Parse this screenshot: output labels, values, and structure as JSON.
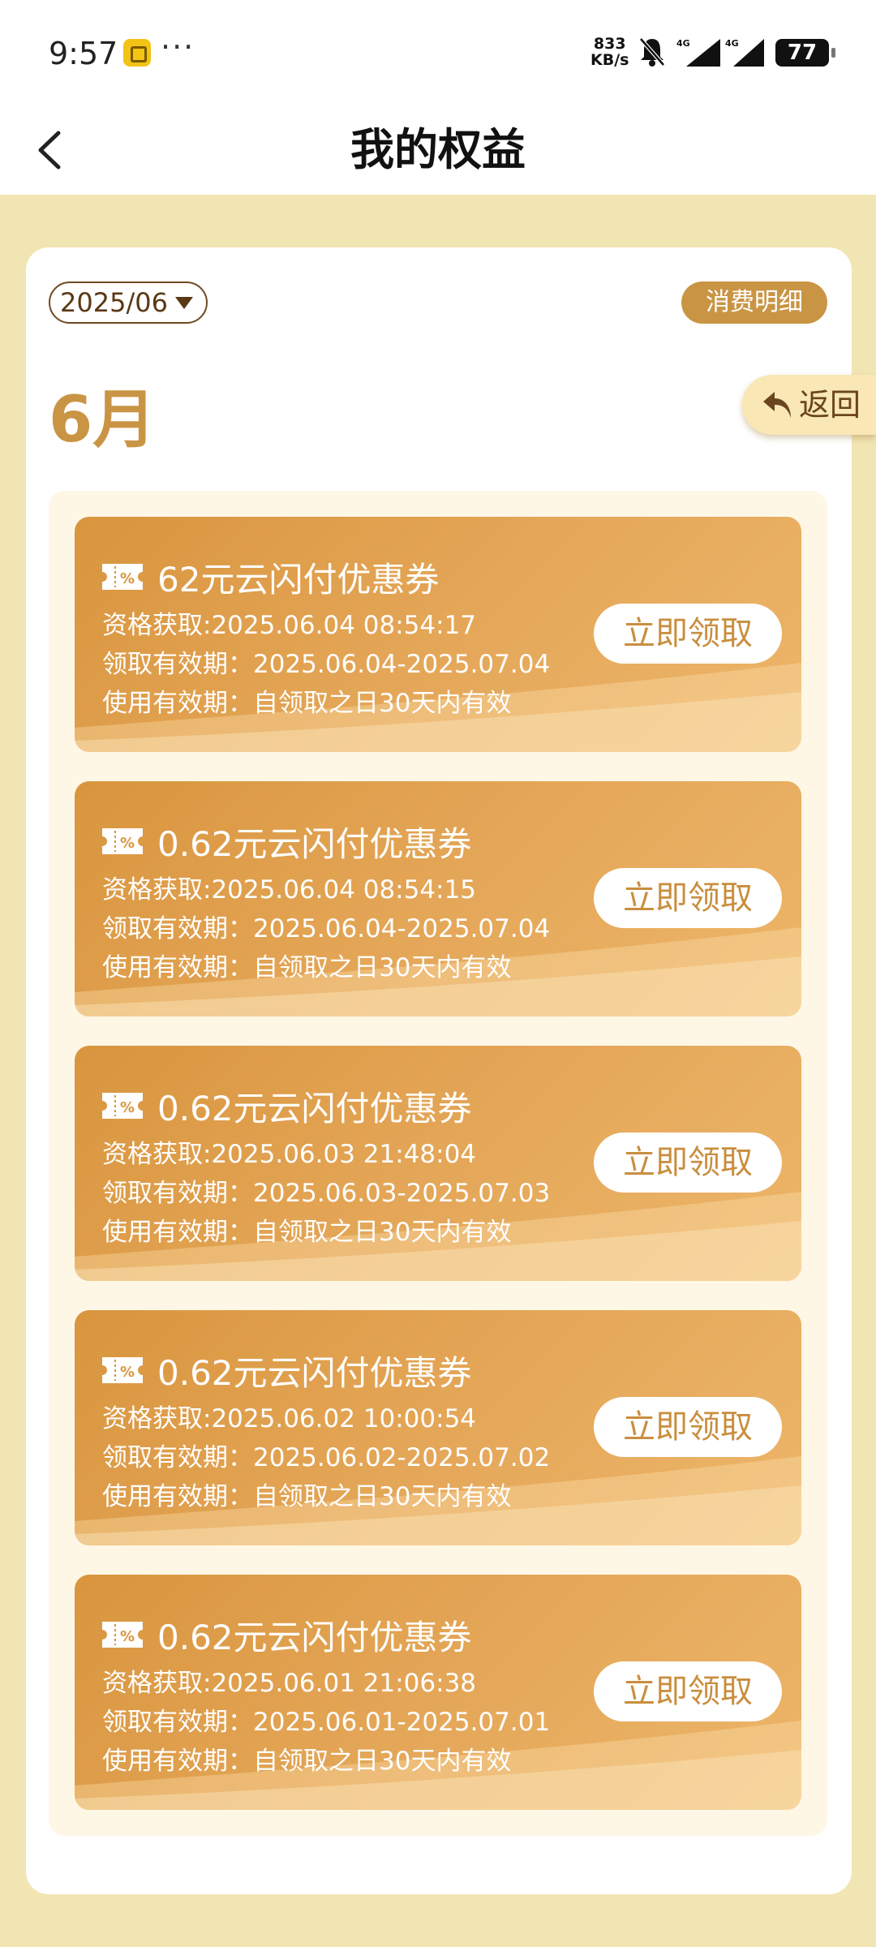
{
  "status_bar": {
    "time": "9:57",
    "net_speed_value": "833",
    "net_speed_unit": "KB/s",
    "battery": "77",
    "signal_label": "4G"
  },
  "header": {
    "title": "我的权益",
    "back_icon": "chevron-left-icon"
  },
  "filter": {
    "month_value": "2025/06",
    "detail_label": "消费明细"
  },
  "month_heading": "6月",
  "return_label": "返回",
  "coupons": [
    {
      "title": "62元云闪付优惠券",
      "acquired": "资格获取:2025.06.04 08:54:17",
      "claim_period": "领取有效期：2025.06.04-2025.07.04",
      "use_period": "使用有效期：自领取之日30天内有效",
      "button": "立即领取"
    },
    {
      "title": "0.62元云闪付优惠券",
      "acquired": "资格获取:2025.06.04 08:54:15",
      "claim_period": "领取有效期：2025.06.04-2025.07.04",
      "use_period": "使用有效期：自领取之日30天内有效",
      "button": "立即领取"
    },
    {
      "title": "0.62元云闪付优惠券",
      "acquired": "资格获取:2025.06.03 21:48:04",
      "claim_period": "领取有效期：2025.06.03-2025.07.03",
      "use_period": "使用有效期：自领取之日30天内有效",
      "button": "立即领取"
    },
    {
      "title": "0.62元云闪付优惠券",
      "acquired": "资格获取:2025.06.02 10:00:54",
      "claim_period": "领取有效期：2025.06.02-2025.07.02",
      "use_period": "使用有效期：自领取之日30天内有效",
      "button": "立即领取"
    },
    {
      "title": "0.62元云闪付优惠券",
      "acquired": "资格获取:2025.06.01 21:06:38",
      "claim_period": "领取有效期：2025.06.01-2025.07.01",
      "use_period": "使用有效期：自领取之日30天内有效",
      "button": "立即领取"
    }
  ],
  "colors": {
    "accent": "#C99545",
    "page_bg": "#F2E5B4",
    "coupon_start": "#D9953E",
    "coupon_end": "#EDB66A"
  }
}
